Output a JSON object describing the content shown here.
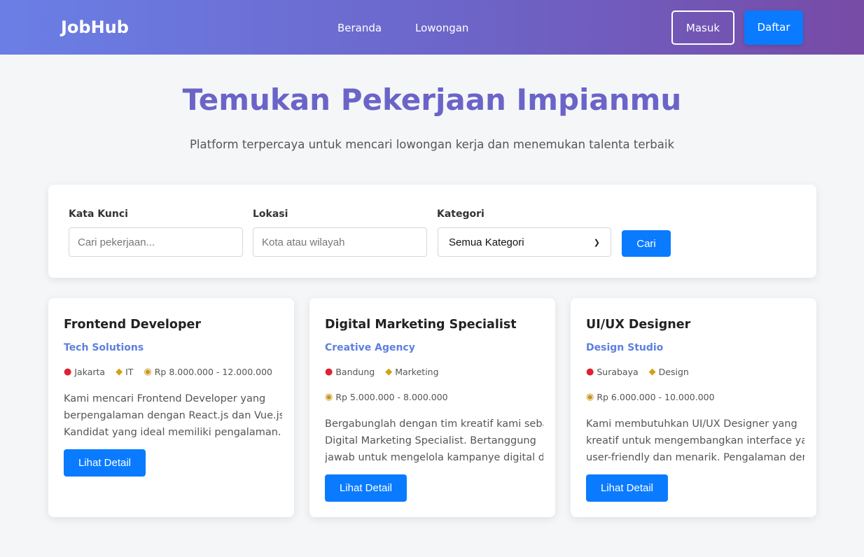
{
  "navbar": {
    "brand": "JobHub",
    "links": [
      "Beranda",
      "Lowongan"
    ],
    "login": "Masuk",
    "register": "Daftar"
  },
  "hero": {
    "title": "Temukan Pekerjaan Impianmu",
    "subtitle": "Platform terpercaya untuk mencari lowongan kerja dan menemukan talenta terbaik"
  },
  "search": {
    "keyword_label": "Kata Kunci",
    "keyword_placeholder": "Cari pekerjaan...",
    "location_label": "Lokasi",
    "location_placeholder": "Kota atau wilayah",
    "category_label": "Kategori",
    "category_selected": "Semua Kategori",
    "button": "Cari"
  },
  "jobs": [
    {
      "title": "Frontend Developer",
      "company": "Tech Solutions",
      "location": "Jakarta",
      "category": "IT",
      "salary": "Rp 8.000.000 - 12.000.000",
      "desc": [
        "Kami mencari Frontend Developer yang",
        "berpengalaman dengan React.js dan Vue.js.",
        "Kandidat yang ideal memiliki pengalaman..."
      ],
      "button": "Lihat Detail"
    },
    {
      "title": "Digital Marketing Specialist",
      "company": "Creative Agency",
      "location": "Bandung",
      "category": "Marketing",
      "salary": "Rp 5.000.000 - 8.000.000",
      "desc": [
        "Bergabunglah dengan tim kreatif kami sebagai",
        "Digital Marketing Specialist. Bertanggung",
        "jawab untuk mengelola kampanye digital dan..."
      ],
      "button": "Lihat Detail"
    },
    {
      "title": "UI/UX Designer",
      "company": "Design Studio",
      "location": "Surabaya",
      "category": "Design",
      "salary": "Rp 6.000.000 - 10.000.000",
      "desc": [
        "Kami membutuhkan UI/UX Designer yang",
        "kreatif untuk mengembangkan interface yang",
        "user-friendly dan menarik. Pengalaman denga..."
      ],
      "button": "Lihat Detail"
    }
  ],
  "icons": {
    "location": "location-pin-icon",
    "category": "tag-icon",
    "salary": "money-bag-icon"
  },
  "colors": {
    "primary": "#0a7bff",
    "accent": "#6b64c8",
    "company": "#5e7fe0"
  }
}
